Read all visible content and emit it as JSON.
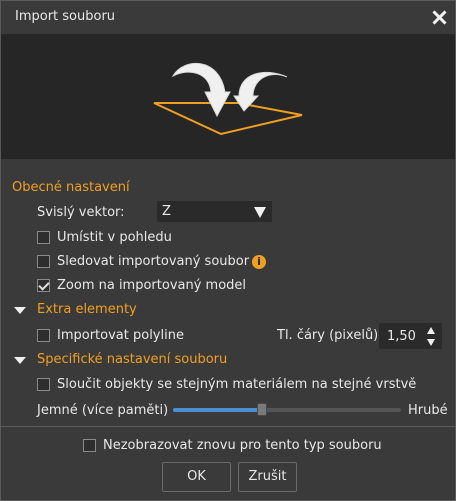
{
  "window": {
    "title": "Import souboru"
  },
  "general": {
    "section_label": "Obecné nastavení",
    "vertical_vector_label": "Svislý vektor:",
    "vertical_vector_value": "Z",
    "place_in_view_label": "Umístit v pohledu",
    "place_in_view_checked": false,
    "track_file_label": "Sledovat importovaný soubor",
    "track_file_checked": false,
    "zoom_label": "Zoom na importovaný model",
    "zoom_checked": true
  },
  "extra": {
    "section_label": "Extra elementy",
    "import_polyline_label": "Importovat polyline",
    "import_polyline_checked": false,
    "line_thickness_label": "Tl. čáry (pixelů)",
    "line_thickness_value": "1,50"
  },
  "specific": {
    "section_label": "Specifické nastavení souboru",
    "merge_label": "Sloučit objekty se stejným materiálem na stejné vrstvě",
    "merge_checked": false,
    "slider_left_label": "Jemné (více paměti)",
    "slider_right_label": "Hrubé",
    "slider_value_fraction": 0.39
  },
  "footer": {
    "dont_show_label": "Nezobrazovat znovu pro tento typ souboru",
    "dont_show_checked": false,
    "ok_label": "OK",
    "cancel_label": "Zrušit"
  },
  "icons": {
    "close": "close-icon",
    "info": "info-icon",
    "import_illustration": "import-arrows-icon"
  },
  "colors": {
    "accent": "#f0a020",
    "slider_fill": "#4a8fd0",
    "background": "#3a3a3a",
    "preview_background": "#262626"
  }
}
